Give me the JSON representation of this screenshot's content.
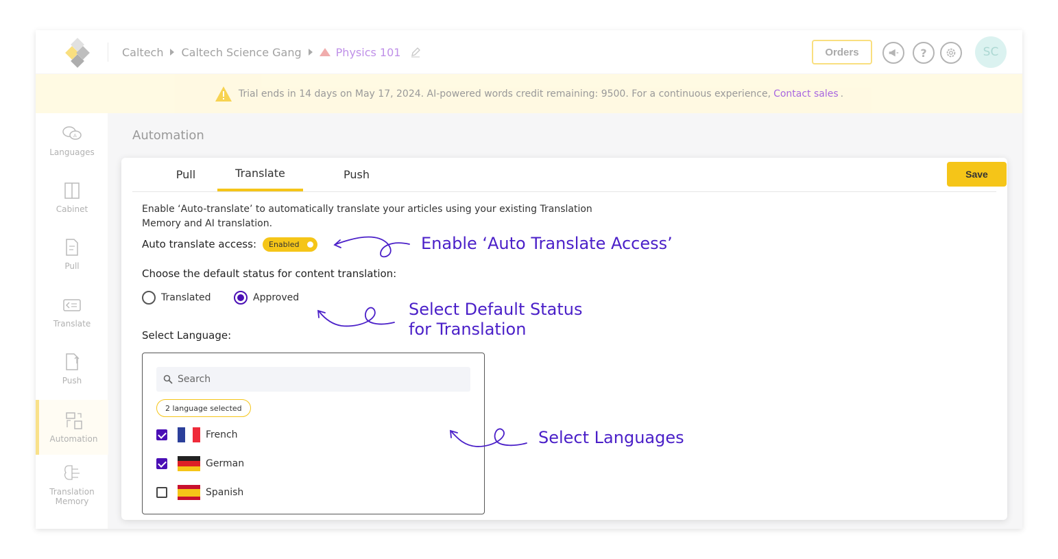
{
  "header": {
    "breadcrumb": [
      "Caltech",
      "Caltech Science Gang"
    ],
    "project": "Physics 101",
    "orders_label": "Orders",
    "avatar_initials": "SC",
    "icons": [
      "announcement-icon",
      "help-icon",
      "settings-icon"
    ]
  },
  "trial": {
    "message": "Trial ends in 14 days on May 17, 2024. AI-powered words credit remaining: 9500. For a continuous experience,",
    "link": "Contact sales",
    "suffix": "."
  },
  "sidebar": {
    "items": [
      {
        "label": "Languages",
        "icon": "languages-icon"
      },
      {
        "label": "Cabinet",
        "icon": "cabinet-icon"
      },
      {
        "label": "Pull",
        "icon": "pull-icon"
      },
      {
        "label": "Translate",
        "icon": "translate-icon"
      },
      {
        "label": "Push",
        "icon": "push-icon"
      },
      {
        "label": "Automation",
        "icon": "automation-icon",
        "active": true
      },
      {
        "label": "Translation Memory",
        "icon": "translation-memory-icon"
      }
    ]
  },
  "main": {
    "title": "Automation",
    "tabs": [
      {
        "label": "Pull"
      },
      {
        "label": "Translate",
        "active": true
      },
      {
        "label": "Push"
      }
    ],
    "save_label": "Save",
    "description": "Enable ‘Auto-translate’ to automatically translate your articles using your existing Translation Memory and AI translation.",
    "access_label": "Auto translate access:",
    "access_state": "Enabled",
    "status_label": "Choose the default status for content translation:",
    "status_options": [
      {
        "label": "Translated",
        "checked": false
      },
      {
        "label": "Approved",
        "checked": true
      }
    ],
    "language_label": "Select Language:",
    "search_placeholder": "Search",
    "selected_badge": "2 language selected",
    "languages": [
      {
        "name": "French",
        "checked": true
      },
      {
        "name": "German",
        "checked": true
      },
      {
        "name": "Spanish",
        "checked": false
      }
    ]
  },
  "annotations": {
    "access": "Enable ‘Auto Translate Access’",
    "status_line1": "Select Default Status",
    "status_line2": "for Translation",
    "languages": "Select Languages"
  },
  "colors": {
    "accent": "#f5c518",
    "purple": "#4a0fb5",
    "annotation": "#4a1fc8",
    "link": "#8b34d6"
  }
}
